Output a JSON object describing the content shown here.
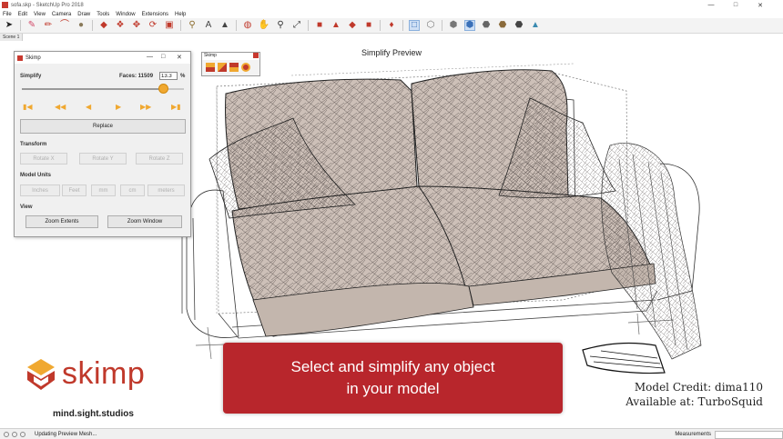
{
  "window": {
    "title": "sofa.skp - SketchUp Pro 2018"
  },
  "menu": [
    "File",
    "Edit",
    "View",
    "Camera",
    "Draw",
    "Tools",
    "Window",
    "Extensions",
    "Help"
  ],
  "scene_tab": "Scene 1",
  "viewport": {
    "preview_title": "Simplify Preview"
  },
  "dialog": {
    "title": "Skimp",
    "simplify_label": "Simplify",
    "faces_label": "Faces: 11509",
    "faces_value": "13.3",
    "percent_sign": "%",
    "slider_fraction": 0.87,
    "replace_label": "Replace",
    "transform_label": "Transform",
    "rotate_x": "Rotate X",
    "rotate_y": "Rotate Y",
    "rotate_z": "Rotate Z",
    "units_label": "Model Units",
    "units": [
      "Inches",
      "Feet",
      "mm",
      "cm",
      "meters"
    ],
    "view_label": "View",
    "zoom_extents": "Zoom Extents",
    "zoom_window": "Zoom Window"
  },
  "float_toolbar": {
    "title": "Skimp"
  },
  "banner": {
    "line1": "Select and simplify any object",
    "line2": "in your model"
  },
  "brand": {
    "name": "skimp",
    "studio": "mind.sight.studios"
  },
  "credit": {
    "line1": "Model Credit: dima110",
    "line2": "Available at: TurboSquid"
  },
  "status": {
    "text": "Updating Preview Mesh...",
    "measurements_label": "Measurements"
  },
  "colors": {
    "accent": "#b8262c",
    "slider_thumb": "#f0a830",
    "brand": "#c0392b"
  }
}
